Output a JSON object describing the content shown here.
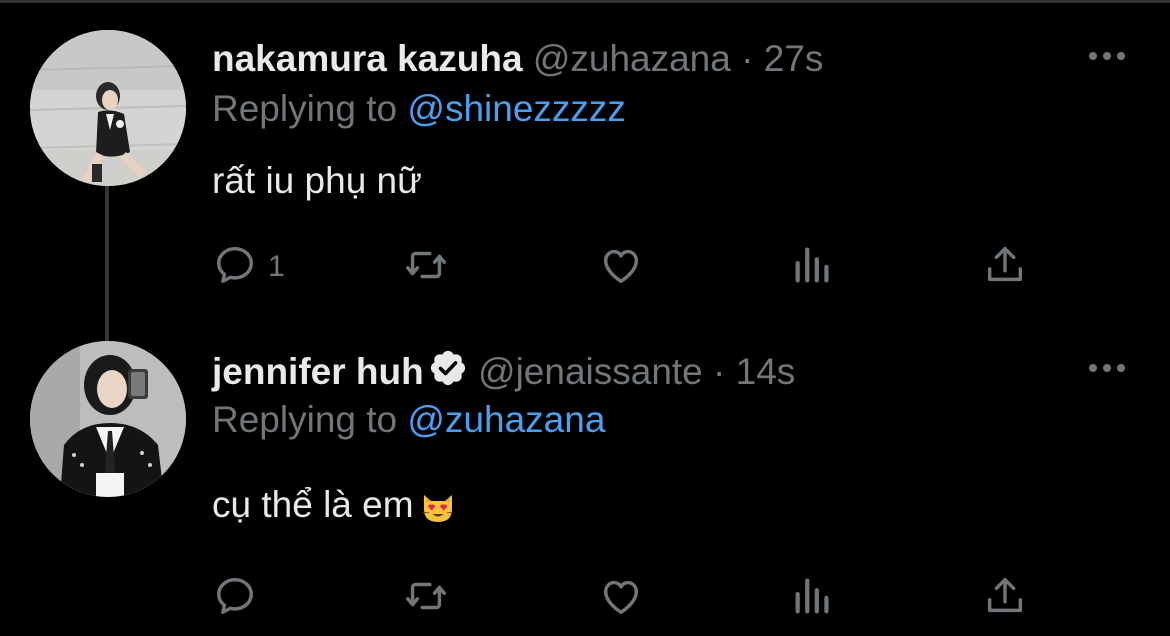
{
  "colors": {
    "background": "#000000",
    "text_primary": "#e7e9ea",
    "text_secondary": "#71767b",
    "mention": "#4a9ff0",
    "verified_badge": "#e7e9ea",
    "thread_line": "#333639"
  },
  "tweets": [
    {
      "display_name": "nakamura kazuha",
      "handle": "@zuhazana",
      "separator": "·",
      "time": "27s",
      "replying_prefix": "Replying to",
      "replying_to": "@shinezzzzz",
      "text": "rất iu phụ nữ",
      "verified": false,
      "reply_count": "1",
      "icons": [
        "reply-icon",
        "retweet-icon",
        "like-icon",
        "views-icon",
        "share-icon",
        "more-icon"
      ]
    },
    {
      "display_name": "jennifer huh",
      "handle": "@jenaissante",
      "separator": "·",
      "time": "14s",
      "replying_prefix": "Replying to",
      "replying_to": "@zuhazana",
      "text": "cụ thể là em",
      "emoji": "heart-eyes-cat-emoji",
      "verified": true,
      "reply_count": "",
      "icons": [
        "reply-icon",
        "retweet-icon",
        "like-icon",
        "views-icon",
        "share-icon",
        "more-icon"
      ]
    }
  ]
}
